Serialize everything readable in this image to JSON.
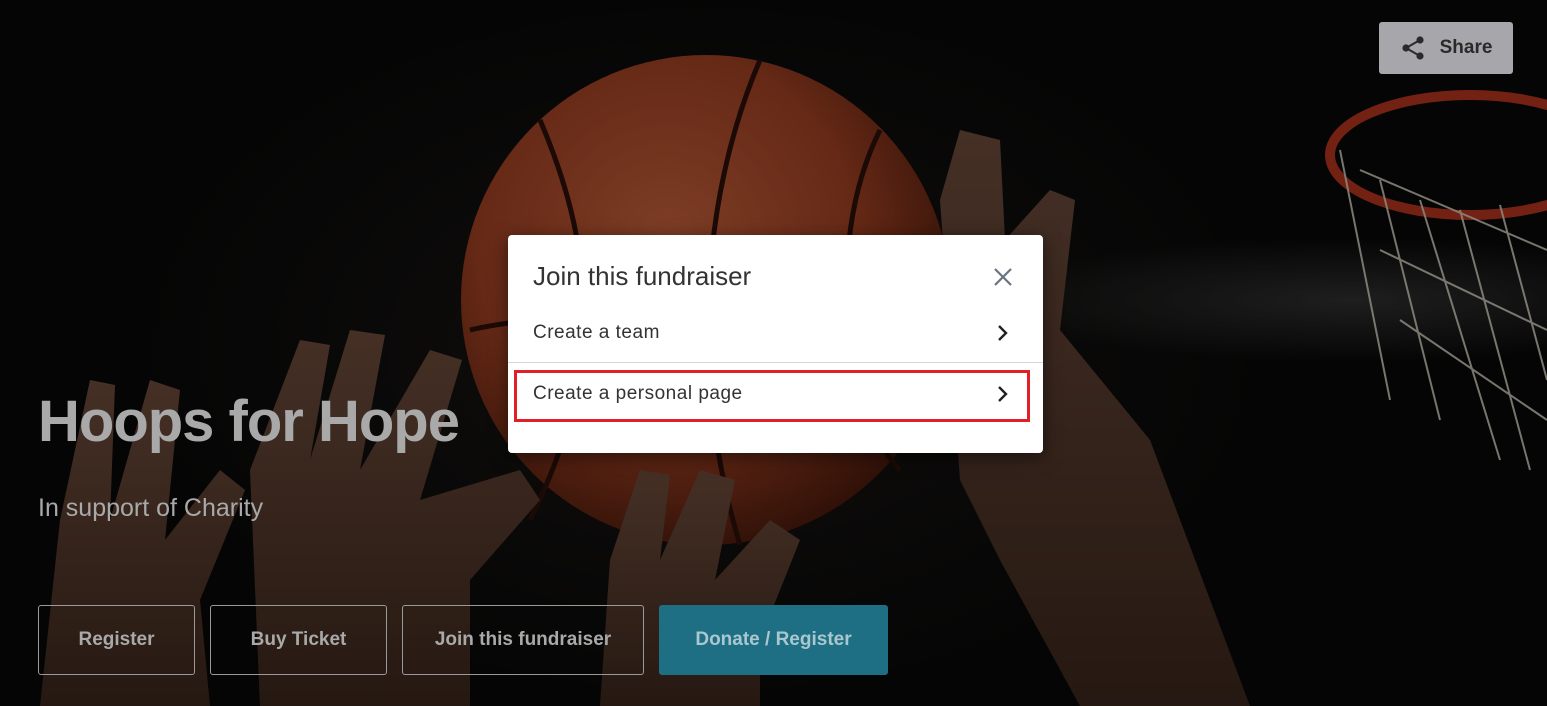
{
  "hero": {
    "title": "Hoops for Hope",
    "subtitle": "In support of Charity"
  },
  "share": {
    "label": "Share",
    "icon": "share-icon"
  },
  "actions": {
    "register": "Register",
    "buy_ticket": "Buy Ticket",
    "join": "Join this fundraiser",
    "donate": "Donate / Register"
  },
  "modal": {
    "title": "Join this fundraiser",
    "options": [
      {
        "label": "Create a team"
      },
      {
        "label": "Create a personal page"
      }
    ]
  },
  "colors": {
    "donate_bg": "#1f6f84",
    "highlight": "#e21f26",
    "share_bg": "#a7a7ab"
  }
}
